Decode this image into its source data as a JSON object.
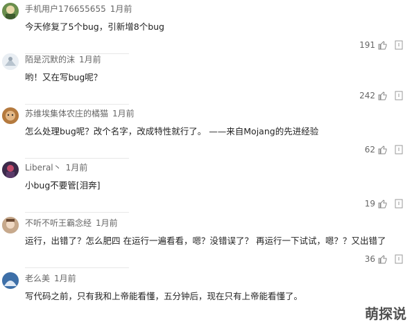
{
  "comments": [
    {
      "user": "手机用户176655655",
      "time": "1月前",
      "text": "今天修复了5个bug，引新增8个bug",
      "likes": "191",
      "avatar_color": "#6a8f4d"
    },
    {
      "user": "陌是沉默的沫",
      "time": "1月前",
      "text": "哟！又在写bug呢？",
      "likes": "242",
      "avatar_color": "#e9eef3"
    },
    {
      "user": "苏维埃集体农庄的橘猫",
      "time": "1月前",
      "text": "怎么处理bug呢？改个名字，改成特性就行了。 ——来自Mojang的先进经验",
      "likes": "62",
      "avatar_color": "#b57a3e"
    },
    {
      "user": "Liberal丶",
      "time": "1月前",
      "text": "小bug不要管[泪奔]",
      "likes": "19",
      "avatar_color": "#3b2a4a"
    },
    {
      "user": "不听不听王霸念经",
      "time": "1月前",
      "text": "运行，出错了？怎么肥四 在运行一遍看看，嗯？没错误了？ 再运行一下试试，嗯？？又出错了",
      "likes": "36",
      "avatar_color": "#c7a98c"
    },
    {
      "user": "老么美",
      "time": "1月前",
      "text": "写代码之前，只有我和上帝能看懂，五分钟后，现在只有上帝能看懂了。",
      "likes": "",
      "avatar_color": "#3d6fa8"
    }
  ],
  "watermark": "萌探说"
}
